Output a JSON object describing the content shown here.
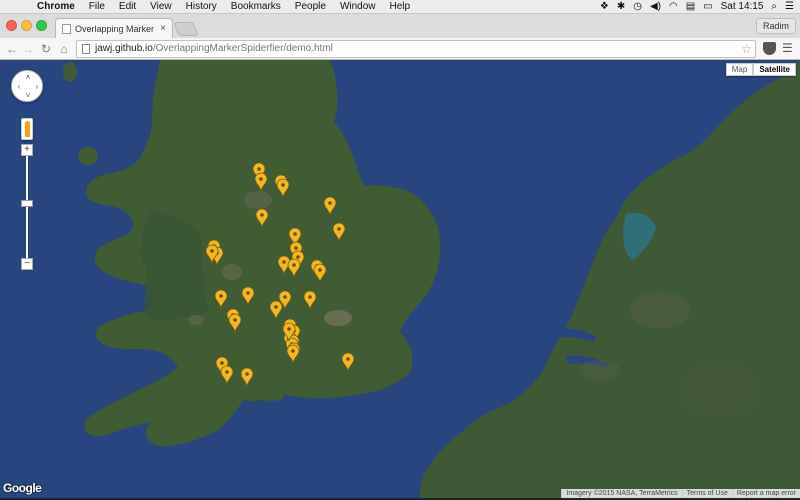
{
  "menubar": {
    "app": "Chrome",
    "items": [
      "File",
      "Edit",
      "View",
      "History",
      "Bookmarks",
      "People",
      "Window",
      "Help"
    ],
    "clock": "Sat 14:15"
  },
  "browser": {
    "tab_title": "Overlapping Marker Spide",
    "profile": "Radim",
    "url_host": "jawj.github.io",
    "url_path": "/OverlappingMarkerSpiderfier/demo.html"
  },
  "map": {
    "type_buttons": [
      "Map",
      "Satellite"
    ],
    "active_type": "Satellite",
    "logo": "Google",
    "attribution": [
      "Imagery ©2015 NASA, TerraMetrics",
      "Terms of Use",
      "Report a map error"
    ],
    "zoom_level_fraction": 0.55,
    "marker_color": "#f3b81f",
    "colors": {
      "sea": "#26477f",
      "land": "#3d5a31",
      "urban": "#7a7660"
    }
  }
}
